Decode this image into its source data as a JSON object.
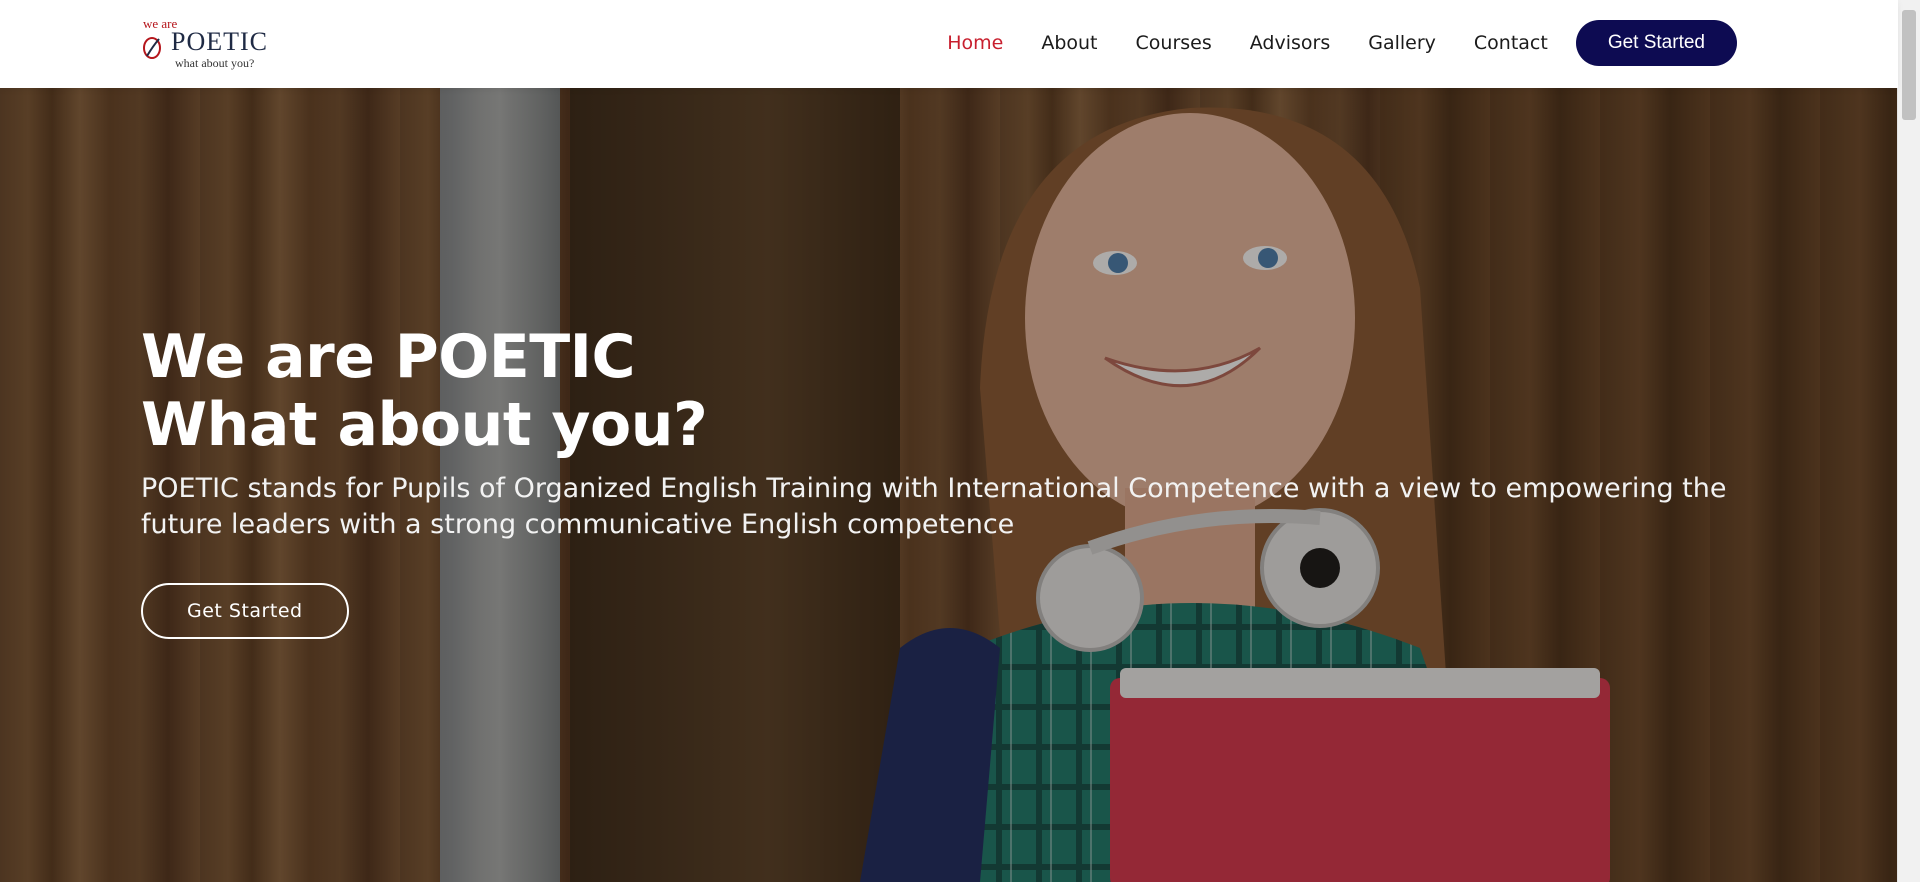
{
  "brand": {
    "logo_top": "we are",
    "logo_name": "POETIC",
    "logo_tagline": "what about you?"
  },
  "nav": {
    "items": [
      {
        "label": "Home",
        "active": true
      },
      {
        "label": "About"
      },
      {
        "label": "Courses"
      },
      {
        "label": "Advisors"
      },
      {
        "label": "Gallery"
      },
      {
        "label": "Contact"
      }
    ],
    "cta_label": "Get Started"
  },
  "hero": {
    "title_line1": "We are POETIC",
    "title_line2": "What about you?",
    "description": "POETIC stands for Pupils of Organized English Training with International Competence with a view to empowering the future leaders with a strong communicative English competence",
    "button_label": "Get Started"
  },
  "colors": {
    "accent_red": "#c8202f",
    "navy": "#0d0b52"
  }
}
